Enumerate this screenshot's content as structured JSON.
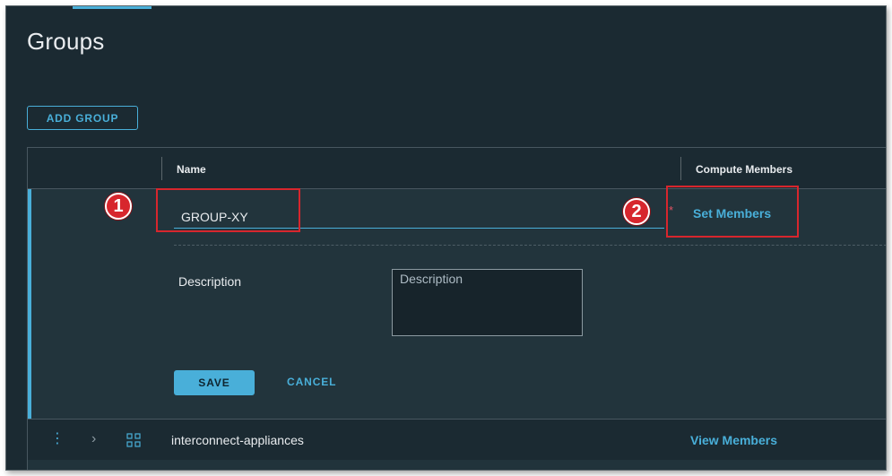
{
  "page": {
    "title": "Groups"
  },
  "toolbar": {
    "add_group_label": "ADD GROUP"
  },
  "grid": {
    "columns": {
      "name": "Name",
      "compute_members": "Compute Members"
    },
    "edit_row": {
      "name_value": "GROUP-XY",
      "required_marker": "*",
      "set_members_label": "Set Members",
      "description_label": "Description",
      "description_placeholder": "Description",
      "save_label": "SAVE",
      "cancel_label": "CANCEL"
    },
    "rows": [
      {
        "name": "interconnect-appliances",
        "members_link": "View Members",
        "menu_glyph": "⋮",
        "expand_glyph": "›"
      }
    ]
  },
  "annotations": [
    {
      "number": "1",
      "target": "name-input"
    },
    {
      "number": "2",
      "target": "set-members-link"
    }
  ],
  "colors": {
    "background": "#1b2a32",
    "accent": "#49afd9",
    "text": "#e9ecef",
    "callout": "#d7262d",
    "required": "#e05263"
  },
  "icons": {
    "row_menu": "vertical-ellipsis-icon",
    "row_expand": "chevron-right-icon",
    "row_type": "group-nodes-icon"
  }
}
